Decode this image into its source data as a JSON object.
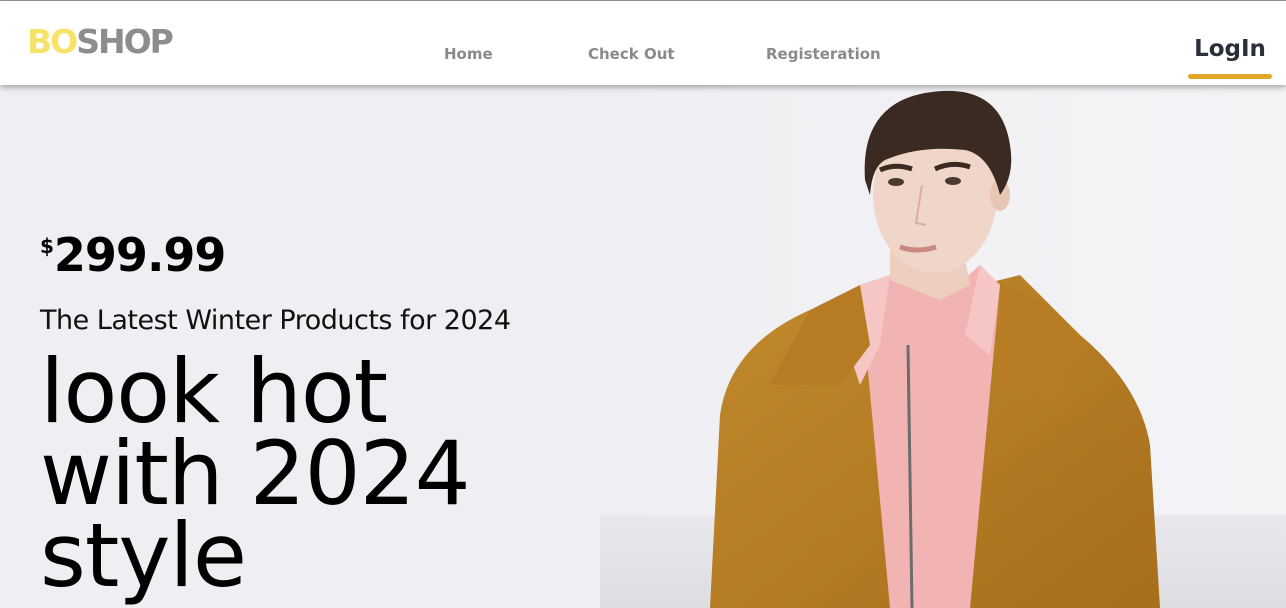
{
  "brand": {
    "logo_part1": "BO",
    "logo_part2": "SHOP",
    "color_part1": "#f8e36a",
    "color_part2": "#8d8d8d"
  },
  "nav": {
    "links": [
      {
        "label": "Home"
      },
      {
        "label": "Check Out"
      },
      {
        "label": "Registeration"
      }
    ],
    "login_label": "LogIn",
    "accent_color": "#e3a526"
  },
  "hero": {
    "currency_symbol": "$",
    "price": "299.99",
    "subtitle": "The Latest Winter Products for 2024",
    "headline_line1": "look hot",
    "headline_line2": "with 2024",
    "headline_line3": "style",
    "image": "model-in-mustard-coat-photo"
  }
}
